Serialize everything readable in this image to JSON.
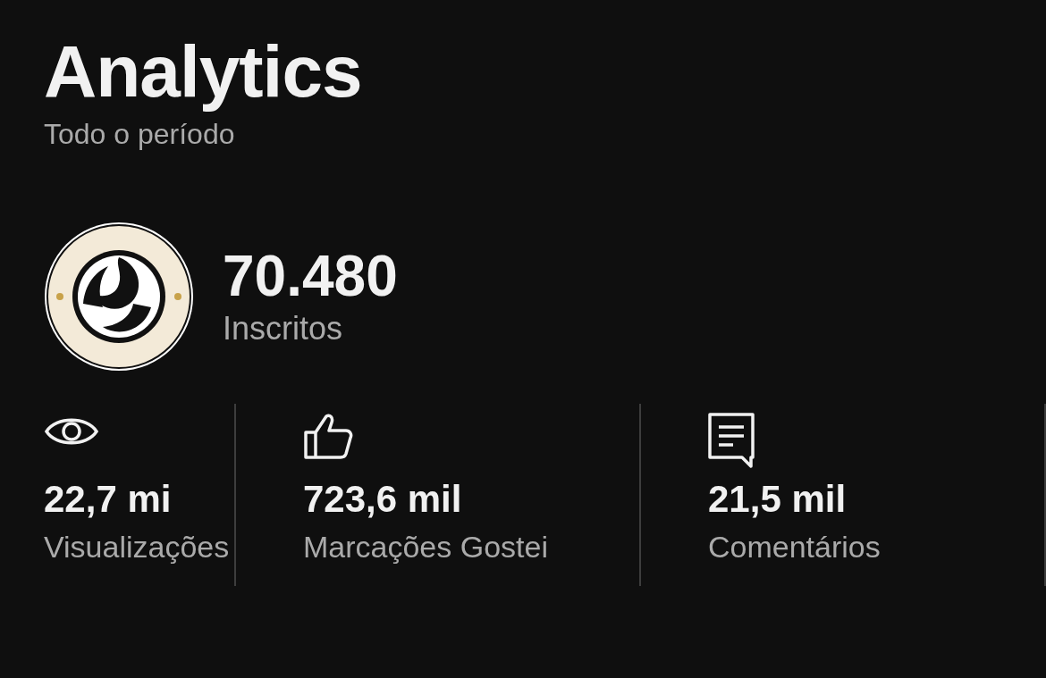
{
  "header": {
    "title": "Analytics",
    "subtitle": "Todo o período"
  },
  "channel": {
    "subscribers": "70.480",
    "subscribers_label": "Inscritos"
  },
  "stats": [
    {
      "kind": "views",
      "value": "22,7 mi",
      "label": "Visualizações"
    },
    {
      "kind": "likes",
      "value": "723,6 mil",
      "label": "Marcações Gostei"
    },
    {
      "kind": "comments",
      "value": "21,5 mil",
      "label": "Comentários"
    }
  ]
}
